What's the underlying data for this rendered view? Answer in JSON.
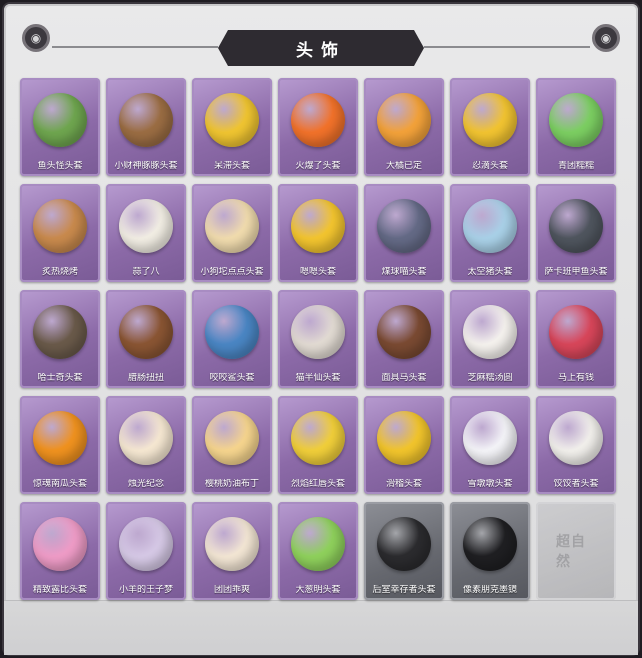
{
  "header": {
    "title": "头饰"
  },
  "items": [
    {
      "label": "鱼头怪头套",
      "icon": "fish-head-mask-icon",
      "color": "#6fa64f"
    },
    {
      "label": "小财神豚豚头套",
      "icon": "capybara-mask-icon",
      "color": "#9b6d43"
    },
    {
      "label": "呆滞头套",
      "icon": "dazed-face-icon",
      "color": "#f0c531"
    },
    {
      "label": "火爆了头套",
      "icon": "flame-face-icon",
      "color": "#f2722a"
    },
    {
      "label": "大橘已定",
      "icon": "orange-slice-icon",
      "color": "#f3a23a"
    },
    {
      "label": "忍滴头套",
      "icon": "holding-tears-face-icon",
      "color": "#f2c431"
    },
    {
      "label": "青团糯糯",
      "icon": "green-rice-ball-icon",
      "color": "#7ccf62"
    },
    {
      "label": "炙热烧烤",
      "icon": "bbq-meat-icon",
      "color": "#c98a4d"
    },
    {
      "label": "蒜了八",
      "icon": "garlic-icon",
      "color": "#f2eee4"
    },
    {
      "label": "小狗坨点点头套",
      "icon": "puppy-face-icon",
      "color": "#f1dcae"
    },
    {
      "label": "嗯嗯头套",
      "icon": "smiling-face-icon",
      "color": "#f3c52f"
    },
    {
      "label": "煤球喵头套",
      "icon": "gray-cat-icon",
      "color": "#646a86"
    },
    {
      "label": "太空猪头套",
      "icon": "space-shark-icon",
      "color": "#a9d1e8"
    },
    {
      "label": "萨卡班甲鱼头套",
      "icon": "sakabanbaspis-fish-icon",
      "color": "#4f555e"
    },
    {
      "label": "哈士奇头套",
      "icon": "husky-sunglasses-icon",
      "color": "#6a5a4a"
    },
    {
      "label": "腊肠扭扭",
      "icon": "dachshund-icon",
      "color": "#8a5533"
    },
    {
      "label": "咬咬鲨头套",
      "icon": "shark-icon",
      "color": "#4a86c4"
    },
    {
      "label": "猫半仙头套",
      "icon": "cat-sunglasses-icon",
      "color": "#e2dbd3"
    },
    {
      "label": "面具马头套",
      "icon": "horse-mask-icon",
      "color": "#7a4a32"
    },
    {
      "label": "芝麻糯汤圆",
      "icon": "tangyuan-icon",
      "color": "#f5f2ee"
    },
    {
      "label": "马上有钱",
      "icon": "red-horse-icon",
      "color": "#d8465a"
    },
    {
      "label": "惊魂南瓜头套",
      "icon": "pumpkin-icon",
      "color": "#f0921f"
    },
    {
      "label": "烛光纪念",
      "icon": "candle-face-icon",
      "color": "#f6e8d2"
    },
    {
      "label": "樱桃奶油布丁",
      "icon": "pudding-icon",
      "color": "#f6d58e"
    },
    {
      "label": "烈焰红唇头套",
      "icon": "pikachu-sunglasses-icon",
      "color": "#f1cf3a"
    },
    {
      "label": "滑稽头套",
      "icon": "funny-face-icon",
      "color": "#f2c52c"
    },
    {
      "label": "雪墩墩头套",
      "icon": "snowman-icon",
      "color": "#f4f4f8"
    },
    {
      "label": "饺饺者头套",
      "icon": "dumpling-icon",
      "color": "#f2f0ec"
    },
    {
      "label": "精致露比头套",
      "icon": "pink-pig-glasses-icon",
      "color": "#ef9cc7"
    },
    {
      "label": "小羊的王子梦",
      "icon": "sheep-crown-icon",
      "color": "#d6c9e6"
    },
    {
      "label": "团团乖爽",
      "icon": "hamster-icon",
      "color": "#f3e6d4"
    },
    {
      "label": "大葱明头套",
      "icon": "scallion-icon",
      "color": "#8fd15c"
    },
    {
      "label": "后室幸存者头套",
      "icon": "gas-mask-helmet-icon",
      "color": "#2b2b2e",
      "tile": "gray"
    },
    {
      "label": "像素朋克墨镜",
      "icon": "pixel-sunglasses-icon",
      "color": "#1f1f22",
      "tile": "gray"
    },
    {
      "label": "",
      "icon": "locked-slot-icon",
      "color": "#b9b9bc",
      "tile": "empty",
      "watermark": "超自然"
    }
  ]
}
